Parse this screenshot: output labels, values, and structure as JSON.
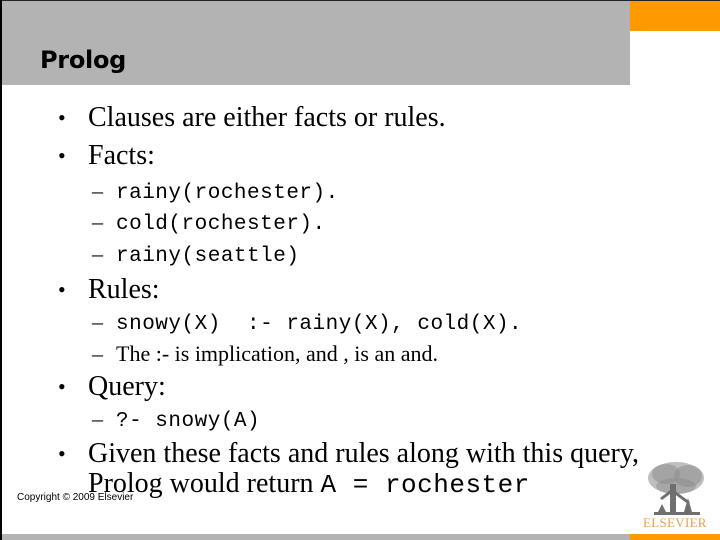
{
  "slide": {
    "title": "Prolog",
    "copyright": "Copyright © 2009 Elsevier",
    "publisher_logo_text": "ELSEVIER",
    "colors": {
      "title_bar": "#b3b3b4",
      "accent": "#ff9900",
      "logo_text": "#e8a24a"
    }
  },
  "bullets": [
    {
      "text": "Clauses are either facts or rules."
    },
    {
      "text": "Facts:",
      "sub": [
        {
          "text": "rainy(rochester).",
          "style": "code"
        },
        {
          "text": "cold(rochester).",
          "style": "code"
        },
        {
          "text": "rainy(seattle)",
          "style": "code"
        }
      ]
    },
    {
      "text": "Rules:",
      "sub": [
        {
          "text": "snowy(X)  :- rainy(X), cold(X).",
          "style": "code"
        },
        {
          "text": "The :- is implication, and , is an and.",
          "style": "text"
        }
      ]
    },
    {
      "text": "Query:",
      "sub": [
        {
          "text": "?- snowy(A)",
          "style": "code"
        }
      ]
    },
    {
      "text_line1": "Given these facts and rules along with this query,",
      "text_line2_prefix": "Prolog would return ",
      "text_line2_code": "A = rochester"
    }
  ],
  "dash": "–",
  "bullet_glyph": "•"
}
